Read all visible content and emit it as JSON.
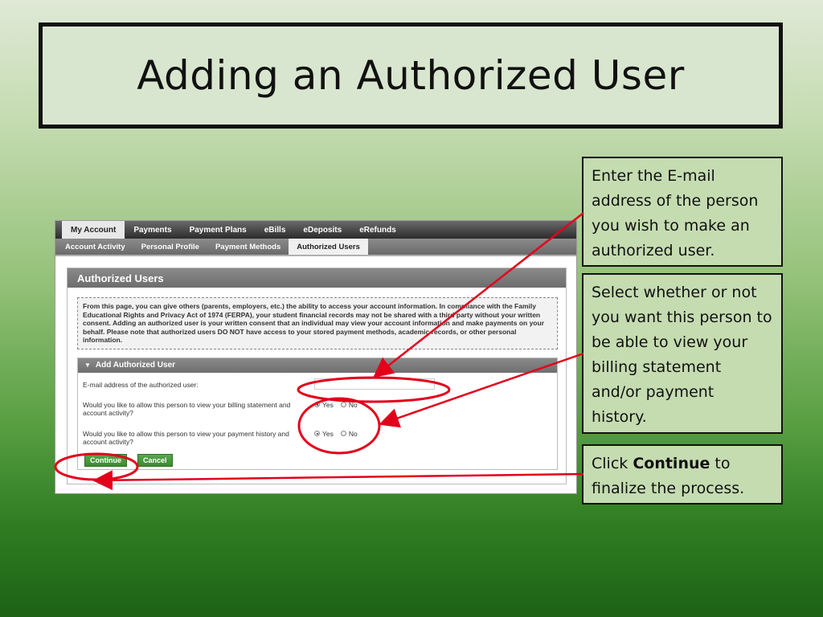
{
  "slide": {
    "title": "Adding an Authorized User"
  },
  "callouts": [
    {
      "text": "Enter the E-mail address of the person you wish to make an authorized user."
    },
    {
      "text": "Select whether or not you want this person to be able to view your billing statement and/or payment history."
    },
    {
      "prefix": "Click ",
      "bold": "Continue",
      "suffix": " to finalize the process."
    }
  ],
  "app": {
    "nav": [
      "My Account",
      "Payments",
      "Payment Plans",
      "eBills",
      "eDeposits",
      "eRefunds"
    ],
    "subnav": [
      "Account Activity",
      "Personal Profile",
      "Payment Methods",
      "Authorized Users"
    ],
    "panel_title": "Authorized Users",
    "info_text": "From this page, you can give others (parents, employers, etc.) the ability to access your account information. In compliance with the Family Educational Rights and Privacy Act of 1974 (FERPA), your student financial records may not be shared with a third party without your written consent. Adding an authorized user is your written consent that an individual may view your account information and make payments on your behalf. Please note that authorized users DO NOT have access to your stored payment methods, academic records, or other personal information.",
    "subpanel_title": "Add Authorized User",
    "email_label": "E-mail address of the authorized user:",
    "email_value": "",
    "billing_question": "Would you like to allow this person to view your billing statement and account activity?",
    "payment_question": "Would you like to allow this person to view your payment history and account activity?",
    "yes_label": "Yes",
    "no_label": "No",
    "continue_label": "Continue",
    "cancel_label": "Cancel"
  },
  "colors": {
    "annotation": "#e3001b",
    "button": "#3b8a30"
  }
}
